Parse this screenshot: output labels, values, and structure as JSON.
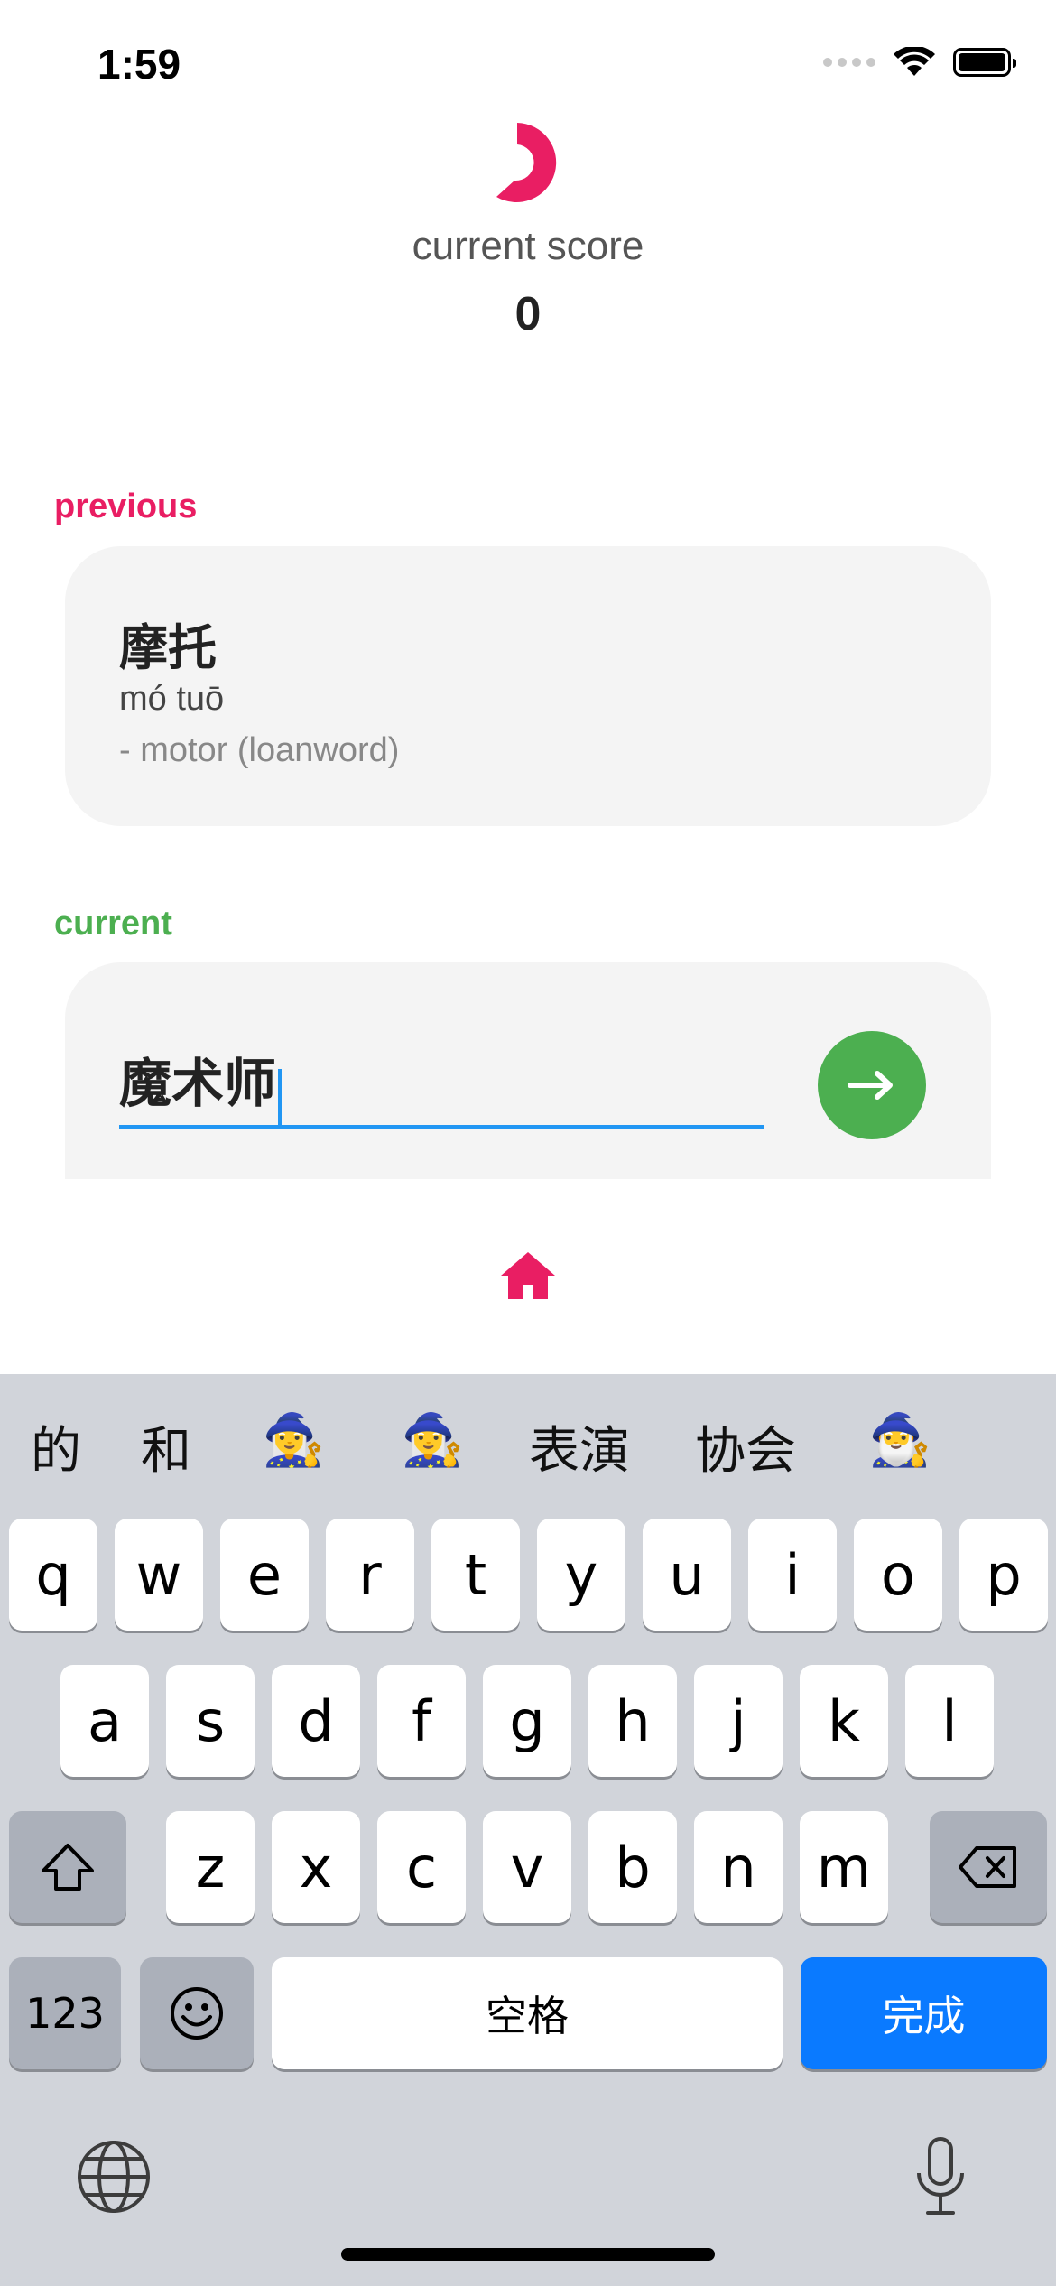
{
  "status": {
    "time": "1:59"
  },
  "score": {
    "label": "current score",
    "value": "0",
    "accent": "#e91e63"
  },
  "previous": {
    "label": "previous",
    "hanzi": "摩托",
    "pinyin": "mó tuō",
    "meaning": "- motor (loanword)"
  },
  "current": {
    "label": "current",
    "input_value": "魔术师",
    "submit_icon": "arrow-right-icon",
    "accent": "#4caf50"
  },
  "nav": {
    "home_icon": "home-icon"
  },
  "keyboard": {
    "candidates": [
      "的",
      "和",
      "🧙‍♀️",
      "🧙‍♀️",
      "表演",
      "协会",
      "🧙‍♂️"
    ],
    "row1": [
      "q",
      "w",
      "e",
      "r",
      "t",
      "y",
      "u",
      "i",
      "o",
      "p"
    ],
    "row2": [
      "a",
      "s",
      "d",
      "f",
      "g",
      "h",
      "j",
      "k",
      "l"
    ],
    "row3": [
      "z",
      "x",
      "c",
      "v",
      "b",
      "n",
      "m"
    ],
    "numbers_label": "123",
    "space_label": "空格",
    "done_label": "完成",
    "icons": [
      "shift-icon",
      "backspace-icon",
      "emoji-icon",
      "globe-icon",
      "microphone-icon"
    ]
  }
}
